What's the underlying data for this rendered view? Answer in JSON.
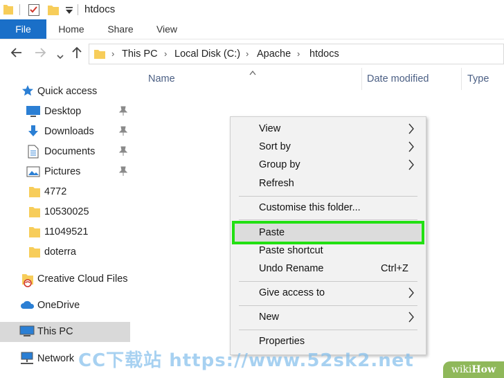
{
  "window": {
    "title": "htdocs"
  },
  "ribbon": {
    "tabs": [
      "File",
      "Home",
      "Share",
      "View"
    ]
  },
  "address": {
    "crumbs": [
      "This PC",
      "Local Disk (C:)",
      "Apache",
      "htdocs"
    ]
  },
  "columns": {
    "name": "Name",
    "date_modified": "Date modified",
    "type": "Type"
  },
  "sidebar": {
    "items": [
      {
        "label": "Quick access",
        "icon": "star-icon"
      },
      {
        "label": "Desktop",
        "icon": "desktop-icon",
        "pinned": true
      },
      {
        "label": "Downloads",
        "icon": "downloads-icon",
        "pinned": true
      },
      {
        "label": "Documents",
        "icon": "documents-icon",
        "pinned": true
      },
      {
        "label": "Pictures",
        "icon": "pictures-icon",
        "pinned": true
      },
      {
        "label": "4772",
        "icon": "folder-icon"
      },
      {
        "label": "10530025",
        "icon": "folder-icon"
      },
      {
        "label": "11049521",
        "icon": "folder-icon"
      },
      {
        "label": "doterra",
        "icon": "folder-icon"
      },
      {
        "label": "Creative Cloud Files",
        "icon": "creative-cloud-icon"
      },
      {
        "label": "OneDrive",
        "icon": "onedrive-icon"
      },
      {
        "label": "This PC",
        "icon": "this-pc-icon",
        "selected": true
      },
      {
        "label": "Network",
        "icon": "network-icon"
      }
    ]
  },
  "context_menu": {
    "items": [
      {
        "label": "View",
        "submenu": true
      },
      {
        "label": "Sort by",
        "submenu": true
      },
      {
        "label": "Group by",
        "submenu": true
      },
      {
        "label": "Refresh"
      },
      {
        "label": "Customise this folder..."
      },
      {
        "label": "Paste",
        "highlighted": true
      },
      {
        "label": "Paste shortcut"
      },
      {
        "label": "Undo Rename",
        "shortcut": "Ctrl+Z"
      },
      {
        "label": "Give access to",
        "submenu": true
      },
      {
        "label": "New",
        "submenu": true
      },
      {
        "label": "Properties"
      }
    ]
  },
  "watermarks": {
    "cc": "CC下载站 https://www.52sk2.net",
    "wiki_a": "wiki",
    "wiki_b": "How"
  },
  "colors": {
    "file_tab": "#1a6fc8",
    "highlight_outline": "#22e012",
    "folder": "#f7cd5a"
  }
}
